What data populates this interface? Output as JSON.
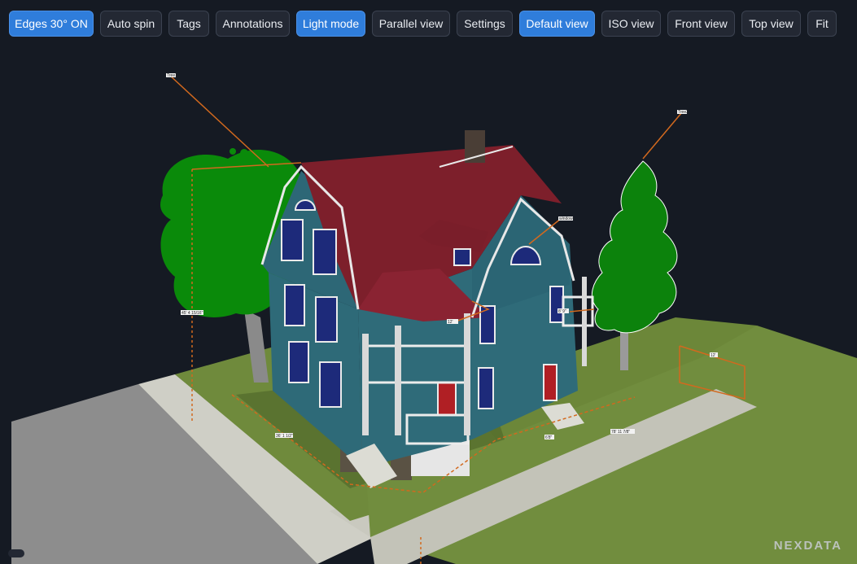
{
  "toolbar": {
    "edges": "Edges 30° ON",
    "auto_spin": "Auto spin",
    "tags": "Tags",
    "annotations": "Annotations",
    "light_mode": "Light mode",
    "parallel_view": "Parallel view",
    "settings": "Settings",
    "default_view": "Default view",
    "iso_view": "ISO view",
    "front_view": "Front view",
    "top_view": "Top view",
    "fit": "Fit"
  },
  "colors": {
    "background": "#151a23",
    "accent": "#2f7ddb",
    "siding": "#2e6a78",
    "roof": "#7d1f2b",
    "grass": "#6f8a3c",
    "dimension_line": "#d2691e"
  },
  "dimensions": {
    "height_label": "45' 4 15/16\"",
    "front_depth": "36' 1 1/2\"",
    "side_length": "78' 11 7/8\"",
    "porch_label": "12'",
    "walk_label": "6'8\"",
    "right_label": "8' 9\"",
    "right_lot": "12'"
  },
  "annotations": {
    "tree_left": "Tree1",
    "tree_right": "Tree2",
    "window_tag": "window"
  },
  "watermark": "NEXDATA"
}
